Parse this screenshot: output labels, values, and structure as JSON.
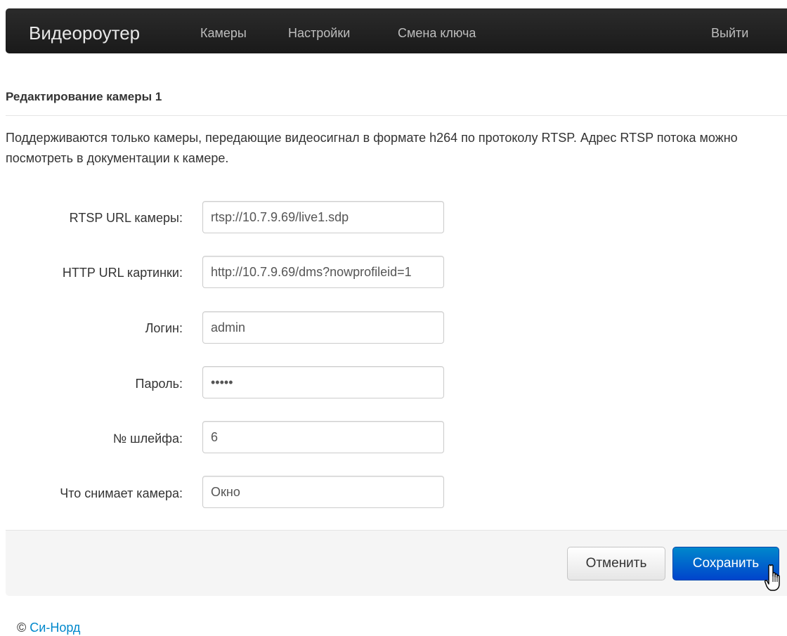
{
  "navbar": {
    "brand": "Видеороутер",
    "links": [
      "Камеры",
      "Настройки",
      "Смена ключа"
    ],
    "logout": "Выйти"
  },
  "page": {
    "title": "Редактирование камеры 1",
    "intro": "Поддерживаются только камеры, передающие видеосигнал в формате h264 по протоколу RTSP. Адрес RTSP потока можно посмотреть в документации к камере."
  },
  "form": {
    "rtsp_url": {
      "label": "RTSP URL камеры:",
      "value": "rtsp://10.7.9.69/live1.sdp"
    },
    "http_url": {
      "label": "HTTP URL картинки:",
      "value": "http://10.7.9.69/dms?nowprofileid=1"
    },
    "login": {
      "label": "Логин:",
      "value": "admin"
    },
    "password": {
      "label": "Пароль:",
      "value": "•••••"
    },
    "loop_number": {
      "label": "№ шлейфа:",
      "value": "6"
    },
    "description": {
      "label": "Что снимает камера:",
      "value": "Окно"
    }
  },
  "actions": {
    "cancel": "Отменить",
    "save": "Сохранить"
  },
  "footer": {
    "copyright": "©",
    "company": "Си-Норд"
  },
  "colors": {
    "navbar_bg": "#1f1f1f",
    "primary": "#0055cc",
    "link": "#0088cc"
  }
}
